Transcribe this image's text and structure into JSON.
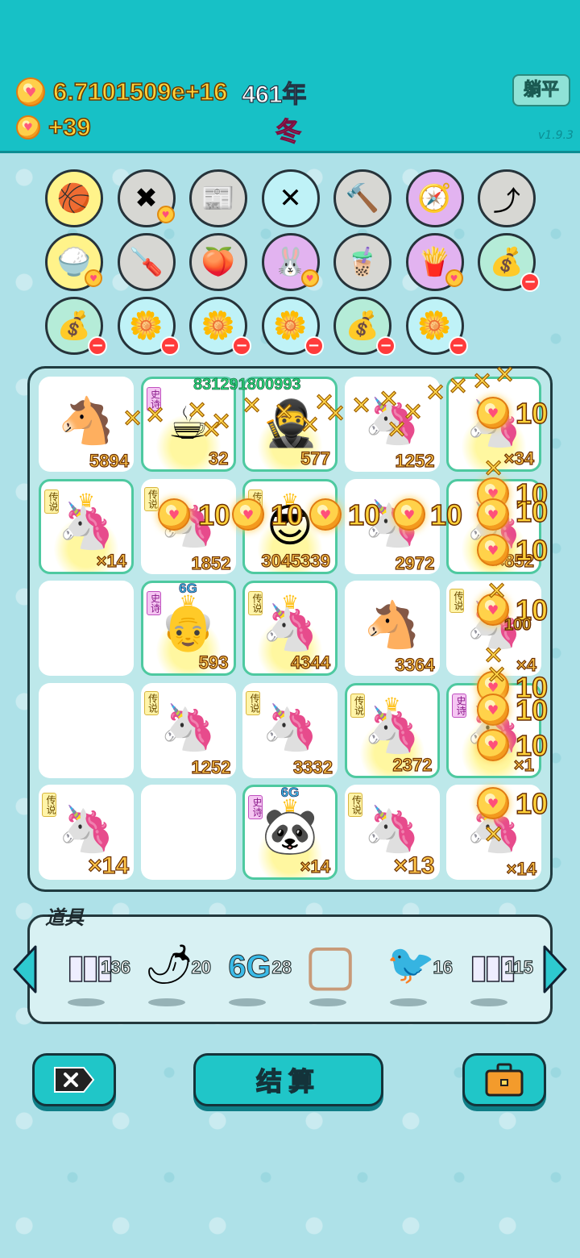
{
  "header": {
    "coins": "6.7101509e+16",
    "year": "461年",
    "income": "+39",
    "season": "冬",
    "lie_flat_button": "躺平",
    "version": "v1.9.3"
  },
  "items": [
    {
      "name": "basketballs",
      "color": "yellow",
      "glyph": "🏀",
      "badge": ""
    },
    {
      "name": "delete-tag",
      "color": "gray",
      "glyph": "✖",
      "badge": "heart"
    },
    {
      "name": "time-magazine",
      "color": "gray",
      "glyph": "📰",
      "badge": ""
    },
    {
      "name": "crossed-sticks",
      "color": "cyan",
      "glyph": "✕",
      "badge": ""
    },
    {
      "name": "hammer",
      "color": "gray",
      "glyph": "🔨",
      "badge": ""
    },
    {
      "name": "compass",
      "color": "purple",
      "glyph": "🧭",
      "badge": ""
    },
    {
      "name": "arrow-card",
      "color": "gray",
      "glyph": "⤴",
      "badge": ""
    },
    {
      "name": "rice-bowl",
      "color": "yellow",
      "glyph": "🍚",
      "badge": "heart"
    },
    {
      "name": "screwdriver",
      "color": "gray",
      "glyph": "🪛",
      "badge": ""
    },
    {
      "name": "eyepatch-peach",
      "color": "gray",
      "glyph": "🍑",
      "badge": ""
    },
    {
      "name": "rabbit",
      "color": "purple",
      "glyph": "🐰",
      "badge": "heart"
    },
    {
      "name": "milk-tea",
      "color": "gray",
      "glyph": "🧋",
      "badge": ""
    },
    {
      "name": "fries",
      "color": "purple",
      "glyph": "🍟",
      "badge": "heart"
    },
    {
      "name": "sack",
      "color": "green",
      "glyph": "💰",
      "badge": "minus"
    },
    {
      "name": "sack",
      "color": "green",
      "glyph": "💰",
      "badge": "minus"
    },
    {
      "name": "flower-pot",
      "color": "cyan",
      "glyph": "🌼",
      "badge": "minus"
    },
    {
      "name": "flower-pot",
      "color": "cyan",
      "glyph": "🌼",
      "badge": "minus"
    },
    {
      "name": "flower-pot",
      "color": "cyan",
      "glyph": "🌼",
      "badge": "minus"
    },
    {
      "name": "sack",
      "color": "green",
      "glyph": "💰",
      "badge": "minus"
    },
    {
      "name": "flower-pot",
      "color": "cyan",
      "glyph": "🌼",
      "badge": "minus"
    }
  ],
  "board": {
    "big_number": "831291800993",
    "cells": [
      {
        "tag": "",
        "glyph": "🐴",
        "count": "5894",
        "glow": false,
        "crown": false,
        "g6": false,
        "big": false
      },
      {
        "tag": "史诗",
        "glyph": "☕",
        "count": "32",
        "glow": true,
        "crown": false,
        "g6": false,
        "big": false
      },
      {
        "tag": "",
        "glyph": "🥷",
        "count": "577",
        "glow": true,
        "crown": false,
        "g6": false,
        "big": false
      },
      {
        "tag": "",
        "glyph": "🦄",
        "count": "1252",
        "glow": false,
        "crown": false,
        "g6": false,
        "big": false
      },
      {
        "tag": "",
        "glyph": "🦄",
        "count": "×34",
        "glow": true,
        "crown": false,
        "g6": false,
        "big": false
      },
      {
        "tag": "传说",
        "glyph": "🦄",
        "count": "×14",
        "glow": true,
        "crown": true,
        "g6": false,
        "big": false
      },
      {
        "tag": "传说",
        "glyph": "🦄",
        "count": "1852",
        "glow": false,
        "crown": false,
        "g6": false,
        "big": false
      },
      {
        "tag": "传说",
        "glyph": "😎",
        "count": "3045339",
        "glow": true,
        "crown": true,
        "g6": false,
        "big": false
      },
      {
        "tag": "",
        "glyph": "🦄",
        "count": "2972",
        "glow": false,
        "crown": false,
        "g6": false,
        "big": false
      },
      {
        "tag": "",
        "glyph": "🦄",
        "count": "×852",
        "glow": true,
        "crown": false,
        "g6": false,
        "big": false
      },
      {
        "tag": "",
        "glyph": "",
        "count": "",
        "glow": false,
        "crown": false,
        "g6": false,
        "big": false
      },
      {
        "tag": "史诗",
        "glyph": "👴",
        "count": "593",
        "glow": true,
        "crown": true,
        "g6": true,
        "big": false
      },
      {
        "tag": "传说",
        "glyph": "🦄",
        "count": "4344",
        "glow": true,
        "crown": true,
        "g6": false,
        "big": false
      },
      {
        "tag": "",
        "glyph": "🐴",
        "count": "3364",
        "glow": false,
        "crown": false,
        "g6": false,
        "big": false
      },
      {
        "tag": "传说",
        "glyph": "🦄",
        "count": "×4",
        "glow": false,
        "crown": false,
        "g6": false,
        "big": false
      },
      {
        "tag": "",
        "glyph": "",
        "count": "",
        "glow": false,
        "crown": false,
        "g6": false,
        "big": false
      },
      {
        "tag": "传说",
        "glyph": "🦄",
        "count": "1252",
        "glow": false,
        "crown": false,
        "g6": false,
        "big": false
      },
      {
        "tag": "传说",
        "glyph": "🦄",
        "count": "3332",
        "glow": false,
        "crown": false,
        "g6": false,
        "big": false
      },
      {
        "tag": "传说",
        "glyph": "🦄",
        "count": "2372",
        "glow": true,
        "crown": true,
        "g6": false,
        "big": false
      },
      {
        "tag": "史诗",
        "glyph": "🦄",
        "count": "×1",
        "glow": true,
        "crown": false,
        "g6": false,
        "big": false
      },
      {
        "tag": "传说",
        "glyph": "🦄",
        "count": "×14",
        "glow": false,
        "crown": false,
        "g6": false,
        "big": true
      },
      {
        "tag": "",
        "glyph": "",
        "count": "",
        "glow": false,
        "crown": false,
        "g6": false,
        "big": false
      },
      {
        "tag": "史诗",
        "glyph": "🐼",
        "count": "×14",
        "glow": true,
        "crown": true,
        "g6": true,
        "big": false
      },
      {
        "tag": "传说",
        "glyph": "🦄",
        "count": "×13",
        "glow": false,
        "crown": false,
        "g6": false,
        "big": true
      },
      {
        "tag": "",
        "glyph": "🦄",
        "count": "×14",
        "glow": false,
        "crown": false,
        "g6": false,
        "big": false
      }
    ],
    "g6_label": "6G",
    "fx_label": "10",
    "fx_small": "100"
  },
  "props": {
    "title": "道具",
    "items": [
      {
        "name": "battery",
        "glyph": "▮▮▮",
        "count": "136"
      },
      {
        "name": "chili",
        "glyph": "🌶",
        "count": "20"
      },
      {
        "name": "6g",
        "glyph": "6G",
        "count": "28"
      },
      {
        "name": "frame",
        "glyph": "▢",
        "count": ""
      },
      {
        "name": "bird",
        "glyph": "🐦",
        "count": "16"
      },
      {
        "name": "battery-upgrade",
        "glyph": "▮▮▮",
        "count": "115"
      }
    ]
  },
  "bottom": {
    "settle_label": "结算"
  }
}
